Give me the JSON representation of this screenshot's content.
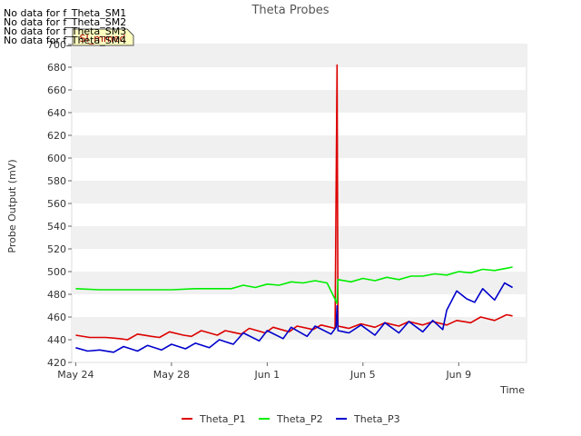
{
  "chart_data": {
    "type": "line",
    "title": "Theta Probes",
    "xlabel": "Time",
    "ylabel": "Probe Output (mV)",
    "ylim": [
      420,
      700
    ],
    "yticks": [
      420,
      440,
      460,
      480,
      500,
      520,
      540,
      560,
      580,
      600,
      620,
      640,
      660,
      680,
      700
    ],
    "xlim": [
      "2021-05-23T20:00",
      "2021-06-11T20:00"
    ],
    "xticks": [
      {
        "label": "May 24",
        "date": "2021-05-24"
      },
      {
        "label": "May 28",
        "date": "2021-05-28"
      },
      {
        "label": "Jun 1",
        "date": "2021-06-01"
      },
      {
        "label": "Jun 5",
        "date": "2021-06-05"
      },
      {
        "label": "Jun 9",
        "date": "2021-06-09"
      }
    ],
    "grid": "horizontal bands",
    "legend_placement": "bottom",
    "no_data_notes": [
      "No data for f_Theta_SM1",
      "No data for f_Theta_SM2",
      "No data for f_Theta_SM3",
      "No data for f_Theta_SM4"
    ],
    "badge": "SI_mmed",
    "series": [
      {
        "name": "Theta_P1",
        "color": "#dd0000",
        "points": [
          [
            "2021-05-24T00:00",
            444
          ],
          [
            "2021-05-24T14:00",
            442
          ],
          [
            "2021-05-25T06:00",
            442
          ],
          [
            "2021-05-25T20:00",
            441
          ],
          [
            "2021-05-26T04:00",
            440
          ],
          [
            "2021-05-26T14:00",
            445
          ],
          [
            "2021-05-27T04:00",
            443
          ],
          [
            "2021-05-27T12:00",
            442
          ],
          [
            "2021-05-27T22:00",
            447
          ],
          [
            "2021-05-28T12:00",
            444
          ],
          [
            "2021-05-28T20:00",
            443
          ],
          [
            "2021-05-29T06:00",
            448
          ],
          [
            "2021-05-29T22:00",
            444
          ],
          [
            "2021-05-30T06:00",
            448
          ],
          [
            "2021-05-30T22:00",
            445
          ],
          [
            "2021-05-31T06:00",
            450
          ],
          [
            "2021-05-31T22:00",
            446
          ],
          [
            "2021-06-01T06:00",
            451
          ],
          [
            "2021-06-01T22:00",
            447
          ],
          [
            "2021-06-02T06:00",
            452
          ],
          [
            "2021-06-02T22:00",
            449
          ],
          [
            "2021-06-03T06:00",
            453
          ],
          [
            "2021-06-03T20:00",
            450
          ],
          [
            "2021-06-03T22:00",
            682
          ],
          [
            "2021-06-03T23:00",
            452
          ],
          [
            "2021-06-04T10:00",
            450
          ],
          [
            "2021-06-04T22:00",
            454
          ],
          [
            "2021-06-05T12:00",
            451
          ],
          [
            "2021-06-05T22:00",
            455
          ],
          [
            "2021-06-06T12:00",
            452
          ],
          [
            "2021-06-06T22:00",
            456
          ],
          [
            "2021-06-07T12:00",
            453
          ],
          [
            "2021-06-07T22:00",
            456
          ],
          [
            "2021-06-08T12:00",
            453
          ],
          [
            "2021-06-08T22:00",
            457
          ],
          [
            "2021-06-09T12:00",
            455
          ],
          [
            "2021-06-09T22:00",
            460
          ],
          [
            "2021-06-10T12:00",
            457
          ],
          [
            "2021-06-11T00:00",
            462
          ],
          [
            "2021-06-11T06:00",
            461
          ]
        ]
      },
      {
        "name": "Theta_P2",
        "color": "#00ee00",
        "points": [
          [
            "2021-05-24T00:00",
            485
          ],
          [
            "2021-05-25T00:00",
            484
          ],
          [
            "2021-05-26T00:00",
            484
          ],
          [
            "2021-05-27T00:00",
            484
          ],
          [
            "2021-05-28T00:00",
            484
          ],
          [
            "2021-05-29T00:00",
            485
          ],
          [
            "2021-05-30T00:00",
            485
          ],
          [
            "2021-05-30T12:00",
            485
          ],
          [
            "2021-05-31T00:00",
            488
          ],
          [
            "2021-05-31T12:00",
            486
          ],
          [
            "2021-06-01T00:00",
            489
          ],
          [
            "2021-06-01T12:00",
            488
          ],
          [
            "2021-06-02T00:00",
            491
          ],
          [
            "2021-06-02T12:00",
            490
          ],
          [
            "2021-06-03T00:00",
            492
          ],
          [
            "2021-06-03T12:00",
            490
          ],
          [
            "2021-06-03T22:00",
            472
          ],
          [
            "2021-06-03T23:00",
            493
          ],
          [
            "2021-06-04T12:00",
            491
          ],
          [
            "2021-06-05T00:00",
            494
          ],
          [
            "2021-06-05T12:00",
            492
          ],
          [
            "2021-06-06T00:00",
            495
          ],
          [
            "2021-06-06T12:00",
            493
          ],
          [
            "2021-06-07T00:00",
            496
          ],
          [
            "2021-06-07T12:00",
            496
          ],
          [
            "2021-06-08T00:00",
            498
          ],
          [
            "2021-06-08T12:00",
            497
          ],
          [
            "2021-06-09T00:00",
            500
          ],
          [
            "2021-06-09T12:00",
            499
          ],
          [
            "2021-06-10T00:00",
            502
          ],
          [
            "2021-06-10T12:00",
            501
          ],
          [
            "2021-06-11T00:00",
            503
          ],
          [
            "2021-06-11T06:00",
            504
          ]
        ]
      },
      {
        "name": "Theta_P3",
        "color": "#0000cc",
        "points": [
          [
            "2021-05-24T00:00",
            433
          ],
          [
            "2021-05-24T12:00",
            430
          ],
          [
            "2021-05-25T00:00",
            431
          ],
          [
            "2021-05-25T14:00",
            429
          ],
          [
            "2021-05-26T00:00",
            434
          ],
          [
            "2021-05-26T14:00",
            430
          ],
          [
            "2021-05-27T00:00",
            435
          ],
          [
            "2021-05-27T14:00",
            431
          ],
          [
            "2021-05-28T00:00",
            436
          ],
          [
            "2021-05-28T14:00",
            432
          ],
          [
            "2021-05-29T00:00",
            437
          ],
          [
            "2021-05-29T14:00",
            433
          ],
          [
            "2021-05-30T00:00",
            440
          ],
          [
            "2021-05-30T14:00",
            436
          ],
          [
            "2021-05-31T00:00",
            446
          ],
          [
            "2021-05-31T16:00",
            439
          ],
          [
            "2021-06-01T00:00",
            448
          ],
          [
            "2021-06-01T16:00",
            441
          ],
          [
            "2021-06-02T00:00",
            451
          ],
          [
            "2021-06-02T16:00",
            443
          ],
          [
            "2021-06-03T00:00",
            452
          ],
          [
            "2021-06-03T16:00",
            445
          ],
          [
            "2021-06-03T21:00",
            451
          ],
          [
            "2021-06-03T22:00",
            470
          ],
          [
            "2021-06-03T23:00",
            448
          ],
          [
            "2021-06-04T10:00",
            446
          ],
          [
            "2021-06-04T22:00",
            453
          ],
          [
            "2021-06-05T12:00",
            444
          ],
          [
            "2021-06-05T22:00",
            455
          ],
          [
            "2021-06-06T12:00",
            446
          ],
          [
            "2021-06-06T22:00",
            456
          ],
          [
            "2021-06-07T12:00",
            447
          ],
          [
            "2021-06-07T22:00",
            457
          ],
          [
            "2021-06-08T08:00",
            449
          ],
          [
            "2021-06-08T12:00",
            466
          ],
          [
            "2021-06-08T22:00",
            483
          ],
          [
            "2021-06-09T08:00",
            476
          ],
          [
            "2021-06-09T16:00",
            473
          ],
          [
            "2021-06-10T00:00",
            485
          ],
          [
            "2021-06-10T12:00",
            475
          ],
          [
            "2021-06-10T22:00",
            490
          ],
          [
            "2021-06-11T06:00",
            486
          ]
        ]
      }
    ]
  }
}
